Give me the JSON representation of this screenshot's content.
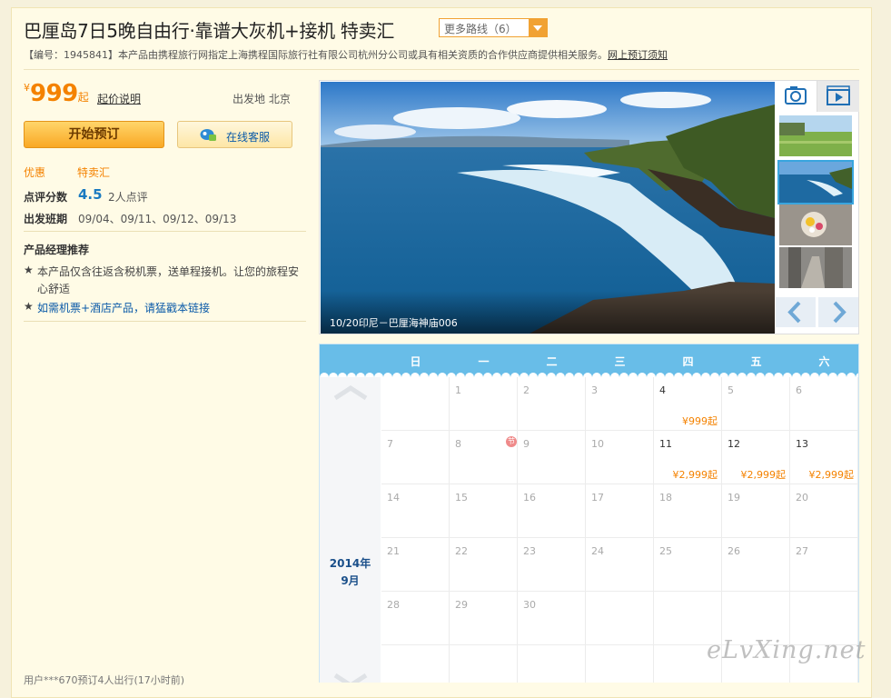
{
  "header": {
    "title": "巴厘岛7日5晚自由行·靠谱大灰机+接机 特卖汇",
    "more_routes": "更多路线（6）",
    "subtitle": "【编号：1945841】本产品由携程旅行网指定上海携程国际旅行社有限公司杭州分公司或具有相关资质的合作供应商提供相关服务。",
    "subtitle_link": "网上预订须知"
  },
  "price": {
    "currency": "¥",
    "amount": "999",
    "suffix": "起",
    "note": "起价说明",
    "origin": "出发地 北京"
  },
  "buttons": {
    "book": "开始预订",
    "service": "在线客服"
  },
  "info": {
    "discount_label": "优惠",
    "discount_value": "特卖汇",
    "score_label": "点评分数",
    "score_value": "4.5",
    "score_count": "2人点评",
    "departure_label": "出发班期",
    "departure_value": "09/04、09/11、09/12、09/13"
  },
  "recommend": {
    "title": "产品经理推荐",
    "star": "★",
    "items": [
      "本产品仅含往返含税机票，送单程接机。让您的旅程安心舒适",
      "如需机票+酒店产品，请猛戳本链接"
    ]
  },
  "bottom_tip": "用户***670预订4人出行(17小时前)",
  "gallery": {
    "caption": "10/20印尼－巴厘海神庙006"
  },
  "calendar": {
    "weekdays": [
      "日",
      "一",
      "二",
      "三",
      "四",
      "五",
      "六"
    ],
    "year": "2014年",
    "month": "9月",
    "holiday_mark": "节",
    "days": [
      {
        "d": "1",
        "p": ""
      },
      {
        "d": "2",
        "p": ""
      },
      {
        "d": "3",
        "p": ""
      },
      {
        "d": "4",
        "p": "¥999起",
        "a": true
      },
      {
        "d": "5",
        "p": ""
      },
      {
        "d": "6",
        "p": ""
      },
      {
        "d": "7",
        "p": ""
      },
      {
        "d": "8",
        "p": ""
      },
      {
        "d": "9",
        "p": ""
      },
      {
        "d": "10",
        "p": ""
      },
      {
        "d": "11",
        "p": "¥2,999起",
        "a": true
      },
      {
        "d": "12",
        "p": "¥2,999起",
        "a": true
      },
      {
        "d": "13",
        "p": "¥2,999起",
        "a": true
      },
      {
        "d": "14",
        "p": ""
      },
      {
        "d": "15",
        "p": ""
      },
      {
        "d": "16",
        "p": ""
      },
      {
        "d": "17",
        "p": ""
      },
      {
        "d": "18",
        "p": ""
      },
      {
        "d": "19",
        "p": ""
      },
      {
        "d": "20",
        "p": ""
      },
      {
        "d": "21",
        "p": ""
      },
      {
        "d": "22",
        "p": ""
      },
      {
        "d": "23",
        "p": ""
      },
      {
        "d": "24",
        "p": ""
      },
      {
        "d": "25",
        "p": ""
      },
      {
        "d": "26",
        "p": ""
      },
      {
        "d": "27",
        "p": ""
      },
      {
        "d": "28",
        "p": ""
      },
      {
        "d": "29",
        "p": ""
      },
      {
        "d": "30",
        "p": ""
      }
    ]
  },
  "watermark": "eLvXing.net"
}
